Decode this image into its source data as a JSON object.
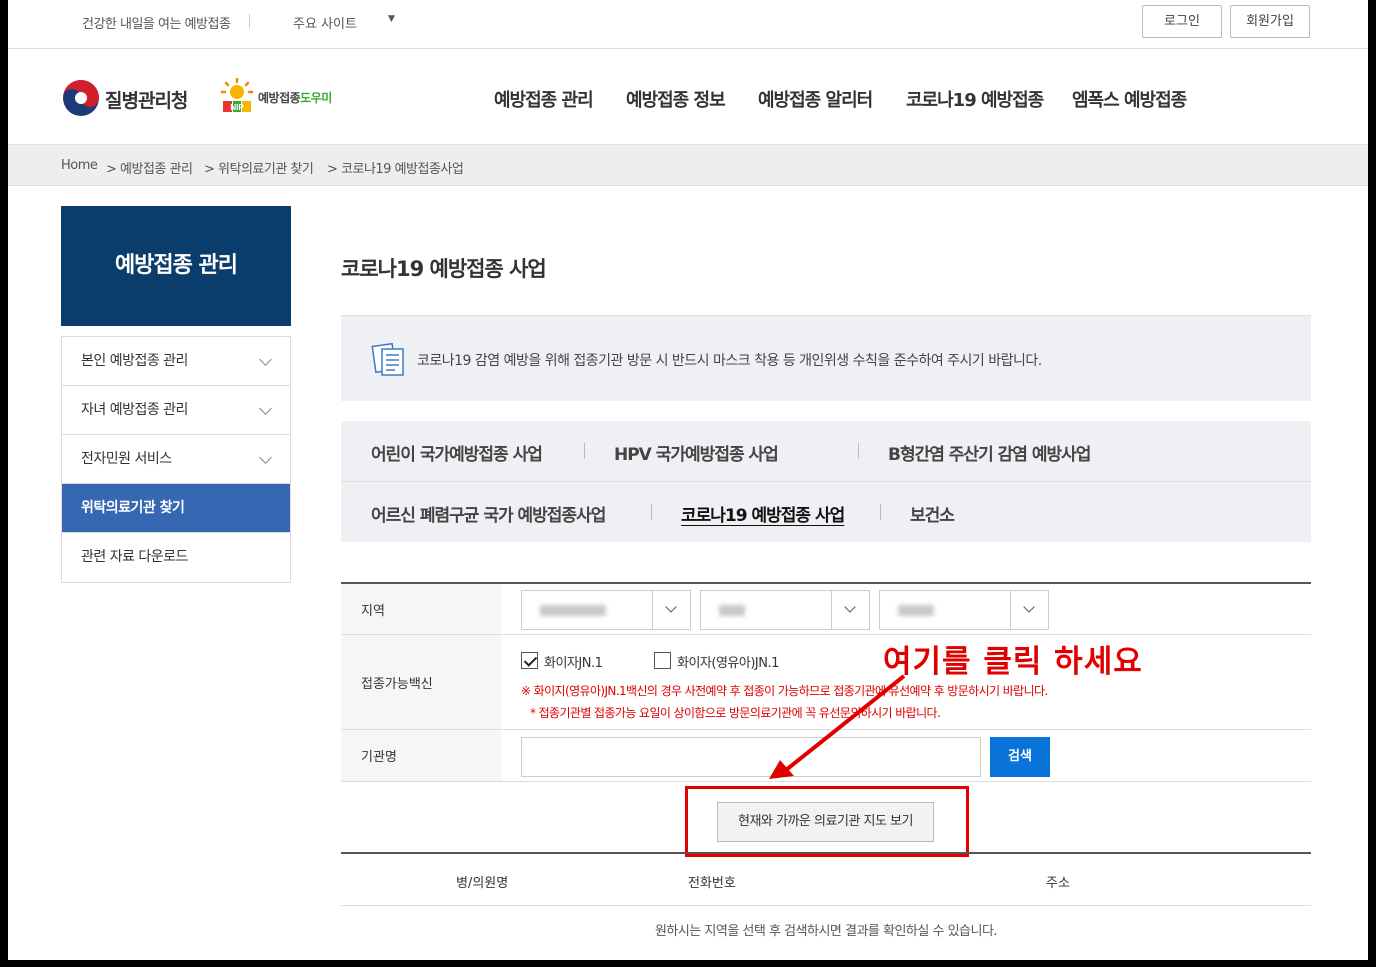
{
  "topbar": {
    "slogan": "건강한 내일을 여는 예방접종",
    "sites": "주요 사이트",
    "sites_caret": "▼",
    "login": "로그인",
    "join": "회원가입"
  },
  "header": {
    "agency": "질병관리청",
    "nip_a": "예방접종",
    "nip_b": "도우미",
    "nip_sub": "NIP",
    "gnb": [
      "예방접종 관리",
      "예방접종 정보",
      "예방접종 알리터",
      "코로나19 예방접종",
      "엠폭스 예방접종"
    ]
  },
  "breadcrumb": [
    "Home",
    "> 예방접종 관리",
    "> 위탁의료기관 찾기",
    "> 코로나19 예방접종사업"
  ],
  "sidebar": {
    "title": "예방접종 관리",
    "items": [
      {
        "label": "본인 예방접종 관리"
      },
      {
        "label": "자녀 예방접종 관리"
      },
      {
        "label": "전자민원 서비스"
      },
      {
        "label": "위탁의료기관 찾기"
      },
      {
        "label": "관련 자료 다운로드"
      }
    ]
  },
  "page": {
    "title": "코로나19 예방접종 사업",
    "notice": "코로나19 감염 예방을 위해 접종기관 방문 시 반드시 마스크 착용 등 개인위생 수칙을 준수하여 주시기 바랍니다."
  },
  "tabs": [
    "어린이 국가예방접종 사업",
    "HPV 국가예방접종 사업",
    "B형간염 주산기 감염 예방사업",
    "어르신 폐렴구균 국가 예방접종사업",
    "코로나19 예방접종 사업",
    "보건소"
  ],
  "form": {
    "region_label": "지역",
    "vaccine_label": "접종가능백신",
    "vaccine_options": [
      {
        "label": "화이자JN.1",
        "checked": true
      },
      {
        "label": "화이자(영유아)JN.1",
        "checked": false
      }
    ],
    "warning1": "※ 화이지(영유아)JN.1백신의 경우 사전예약 후 접종이 가능하므로 접종기관에 유선예약 후 방문하시기 바랍니다.",
    "warning2": "* 접종기관별 접종가능 요일이 상이함으로 방문의료기관에 꼭 유선문의하시기 바랍니다.",
    "name_label": "기관명",
    "search": "검색"
  },
  "map_button": "현재와 가까운 의료기관 지도 보기",
  "result": {
    "headers": [
      "병/의원명",
      "전화번호",
      "주소"
    ],
    "empty": "원하시는 지역을 선택 후 검색하시면 결과를 확인하실 수 있습니다."
  },
  "annotation": {
    "text": "여기를 클릭 하세요",
    "color": "#e00000"
  },
  "colors": {
    "primary_dark": "#0a3d6b",
    "active_menu": "#3667b3",
    "search_button": "#0a73d9"
  }
}
